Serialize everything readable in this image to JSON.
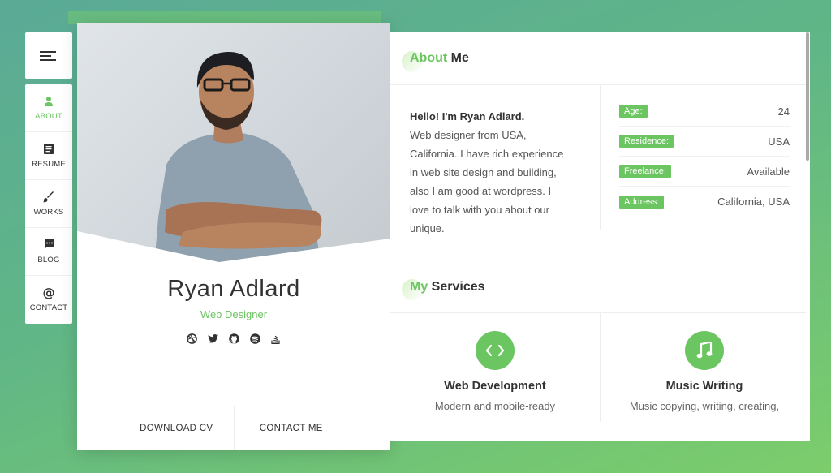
{
  "nav": {
    "menu_icon": "hamburger-icon",
    "items": [
      {
        "label": "ABOUT",
        "icon": "person-icon",
        "active": true
      },
      {
        "label": "RESUME",
        "icon": "document-icon",
        "active": false
      },
      {
        "label": "WORKS",
        "icon": "brush-icon",
        "active": false
      },
      {
        "label": "BLOG",
        "icon": "chat-icon",
        "active": false
      },
      {
        "label": "CONTACT",
        "icon": "at-icon",
        "active": false
      }
    ]
  },
  "profile": {
    "name": "Ryan Adlard",
    "role": "Web Designer",
    "socials": [
      "dribbble-icon",
      "twitter-icon",
      "github-icon",
      "spotify-icon",
      "stackoverflow-icon"
    ],
    "download_label": "DOWNLOAD CV",
    "contact_label": "CONTACT ME"
  },
  "about": {
    "title_accent": "About",
    "title_rest": " Me",
    "greeting": "Hello! I'm Ryan Adlard.",
    "lines": [
      "Web designer from USA,",
      "California. I have rich experience",
      "in web site design and building,",
      "also I am good at wordpress. I",
      "love to talk with you about our",
      "unique."
    ],
    "info": [
      {
        "label": "Age:",
        "value": "24"
      },
      {
        "label": "Residence:",
        "value": "USA"
      },
      {
        "label": "Freelance:",
        "value": "Available"
      },
      {
        "label": "Address:",
        "value": "California, USA"
      }
    ]
  },
  "services": {
    "title_accent": "My",
    "title_rest": " Services",
    "items": [
      {
        "title": "Web Development",
        "desc": "Modern and mobile-ready",
        "icon": "code-icon"
      },
      {
        "title": "Music Writing",
        "desc": "Music copying, writing, creating,",
        "icon": "music-note-icon"
      }
    ]
  },
  "colors": {
    "accent": "#6bc560",
    "background": "#60b686"
  }
}
